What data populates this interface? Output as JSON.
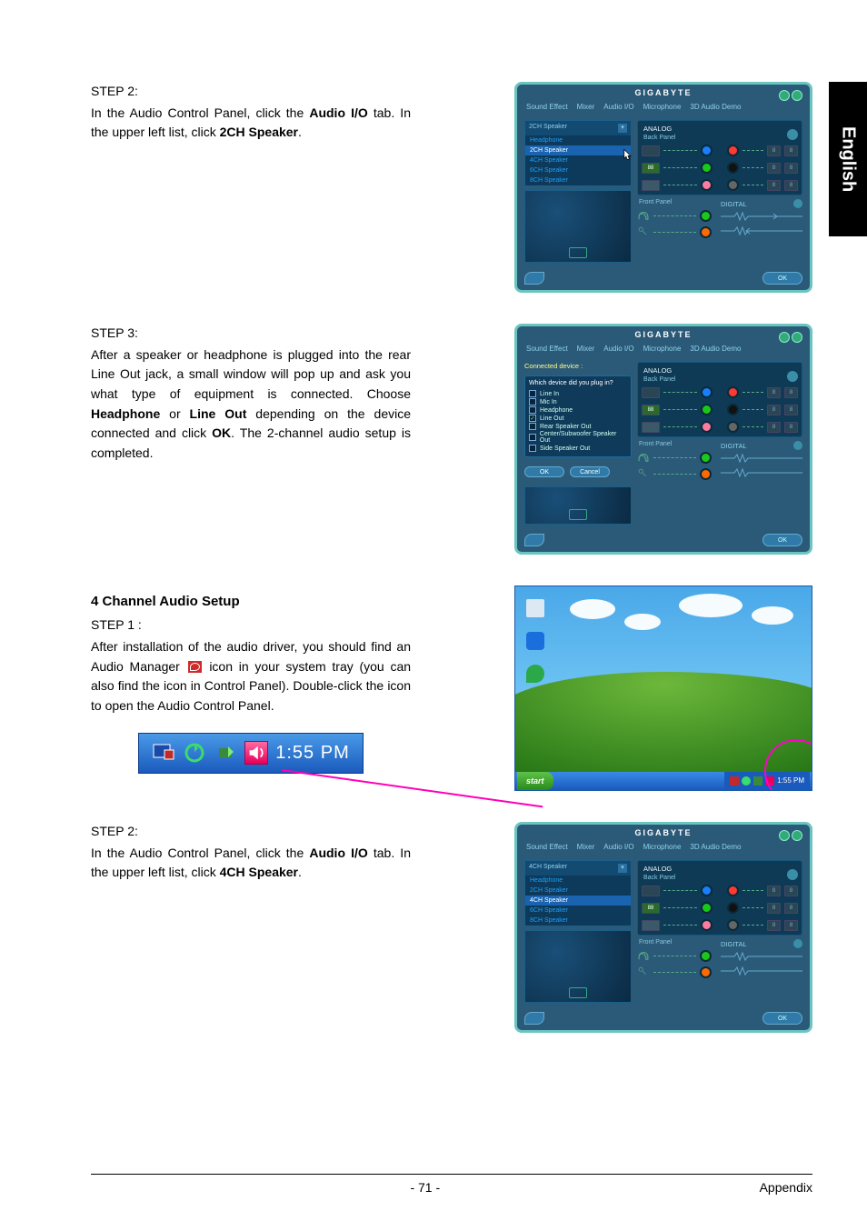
{
  "language_tab": "English",
  "sections": {
    "s1": {
      "title": "STEP 2:",
      "body_a": "In the Audio Control Panel, click the ",
      "bold_a": "Audio I/O",
      "body_b": " tab. In the upper left list, click ",
      "bold_b": "2CH Speaker",
      "body_c": "."
    },
    "s2": {
      "title": "STEP 3:",
      "body_a": "After a speaker or headphone is plugged into the rear Line Out jack, a small window will pop up and ask you what type of equipment is connected. Choose ",
      "bold_a": "Headphone",
      "body_b": " or ",
      "bold_b": "Line Out",
      "body_c": " depending on the device connected and click ",
      "bold_c": "OK",
      "body_d": ". The 2-channel audio setup is completed."
    },
    "s3": {
      "heading": "4 Channel Audio Setup",
      "title": "STEP 1 :",
      "body_a": "After installation of the audio driver, you should find an Audio Manager",
      "body_b": "icon in your system tray (you can also find the icon in Control Panel). Double-click the icon to open the Audio Control Panel."
    },
    "s4": {
      "title": "STEP 2:",
      "body_a": "In the Audio Control Panel, click the ",
      "bold_a": "Audio I/O",
      "body_b": " tab. In the upper left list, click ",
      "bold_b": "4CH Speaker",
      "body_c": "."
    }
  },
  "acp": {
    "brand": "GIGABYTE",
    "tabs": [
      "Sound Effect",
      "Mixer",
      "Audio I/O",
      "Microphone",
      "3D Audio Demo"
    ],
    "dropdown_2ch": {
      "top": "2CH Speaker",
      "options": [
        "Headphone",
        "2CH Speaker",
        "4CH Speaker",
        "6CH Speaker",
        "8CH Speaker"
      ]
    },
    "dropdown_4ch": {
      "top": "4CH Speaker",
      "options": [
        "Headphone",
        "2CH Speaker",
        "4CH Speaker",
        "6CH Speaker",
        "8CH Speaker"
      ]
    },
    "analog": "ANALOG",
    "back_panel": "Back Panel",
    "front_panel": "Front Panel",
    "digital": "DIGITAL",
    "ok": "OK",
    "sp_label": "88"
  },
  "popup": {
    "connected": "Connected device :",
    "question": "Which device did you plug in?",
    "options": [
      "Line In",
      "Mic In",
      "Headphone",
      "Line Out",
      "Rear Speaker Out",
      "Center/Subwoofer Speaker Out",
      "Side Speaker Out"
    ],
    "checked_index": 3,
    "ok": "OK",
    "cancel": "Cancel"
  },
  "systray": {
    "time": "1:55 PM",
    "start": "start"
  },
  "footer": {
    "page": "- 71 -",
    "section": "Appendix"
  }
}
